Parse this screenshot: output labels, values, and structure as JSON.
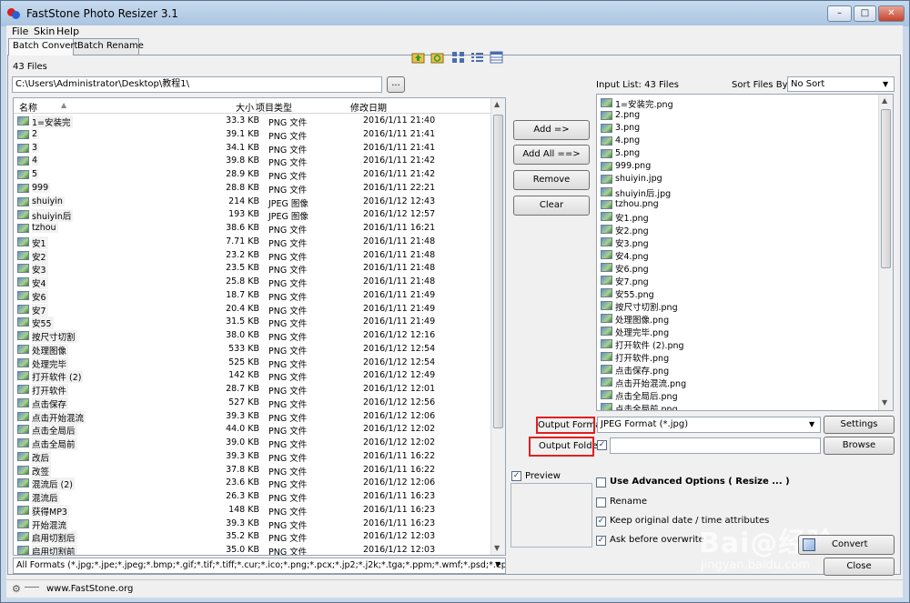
{
  "window": {
    "title": "FastStone Photo Resizer 3.1",
    "min_glyph": "–",
    "max_glyph": "□",
    "close_glyph": "✕"
  },
  "menu": [
    "File",
    "Skin",
    "Help"
  ],
  "tabs": [
    "Batch Convert",
    "Batch Rename"
  ],
  "file_count": "43 Files",
  "path": {
    "value": "C:\\Users\\Administrator\\Desktop\\教程1\\",
    "browse_label": "..."
  },
  "columns": {
    "name": "名称",
    "size": "大小",
    "type": "项目类型",
    "date": "修改日期"
  },
  "files": [
    {
      "name": "1=安装完",
      "size": "33.3 KB",
      "type": "PNG 文件",
      "date": "2016/1/11 21:40"
    },
    {
      "name": "2",
      "size": "39.1 KB",
      "type": "PNG 文件",
      "date": "2016/1/11 21:41"
    },
    {
      "name": "3",
      "size": "34.1 KB",
      "type": "PNG 文件",
      "date": "2016/1/11 21:41"
    },
    {
      "name": "4",
      "size": "39.8 KB",
      "type": "PNG 文件",
      "date": "2016/1/11 21:42"
    },
    {
      "name": "5",
      "size": "28.9 KB",
      "type": "PNG 文件",
      "date": "2016/1/11 21:42"
    },
    {
      "name": "999",
      "size": "28.8 KB",
      "type": "PNG 文件",
      "date": "2016/1/11 22:21"
    },
    {
      "name": "shuiyin",
      "size": "214 KB",
      "type": "JPEG 图像",
      "date": "2016/1/12 12:43"
    },
    {
      "name": "shuiyin后",
      "size": "193 KB",
      "type": "JPEG 图像",
      "date": "2016/1/12 12:57"
    },
    {
      "name": "tzhou",
      "size": "38.6 KB",
      "type": "PNG 文件",
      "date": "2016/1/11 16:21"
    },
    {
      "name": "安1",
      "size": "7.71 KB",
      "type": "PNG 文件",
      "date": "2016/1/11 21:48"
    },
    {
      "name": "安2",
      "size": "23.2 KB",
      "type": "PNG 文件",
      "date": "2016/1/11 21:48"
    },
    {
      "name": "安3",
      "size": "23.5 KB",
      "type": "PNG 文件",
      "date": "2016/1/11 21:48"
    },
    {
      "name": "安4",
      "size": "25.8 KB",
      "type": "PNG 文件",
      "date": "2016/1/11 21:48"
    },
    {
      "name": "安6",
      "size": "18.7 KB",
      "type": "PNG 文件",
      "date": "2016/1/11 21:49"
    },
    {
      "name": "安7",
      "size": "20.4 KB",
      "type": "PNG 文件",
      "date": "2016/1/11 21:49"
    },
    {
      "name": "安55",
      "size": "31.5 KB",
      "type": "PNG 文件",
      "date": "2016/1/11 21:49"
    },
    {
      "name": "按尺寸切割",
      "size": "38.0 KB",
      "type": "PNG 文件",
      "date": "2016/1/12 12:16"
    },
    {
      "name": "处理图像",
      "size": "533 KB",
      "type": "PNG 文件",
      "date": "2016/1/12 12:54"
    },
    {
      "name": "处理完毕",
      "size": "525 KB",
      "type": "PNG 文件",
      "date": "2016/1/12 12:54"
    },
    {
      "name": "打开软件 (2)",
      "size": "142 KB",
      "type": "PNG 文件",
      "date": "2016/1/12 12:49"
    },
    {
      "name": "打开软件",
      "size": "28.7 KB",
      "type": "PNG 文件",
      "date": "2016/1/12 12:01"
    },
    {
      "name": "点击保存",
      "size": "527 KB",
      "type": "PNG 文件",
      "date": "2016/1/12 12:56"
    },
    {
      "name": "点击开始混流",
      "size": "39.3 KB",
      "type": "PNG 文件",
      "date": "2016/1/12 12:06"
    },
    {
      "name": "点击全局后",
      "size": "44.0 KB",
      "type": "PNG 文件",
      "date": "2016/1/12 12:02"
    },
    {
      "name": "点击全局前",
      "size": "39.0 KB",
      "type": "PNG 文件",
      "date": "2016/1/12 12:02"
    },
    {
      "name": "改后",
      "size": "39.3 KB",
      "type": "PNG 文件",
      "date": "2016/1/11 16:22"
    },
    {
      "name": "改签",
      "size": "37.8 KB",
      "type": "PNG 文件",
      "date": "2016/1/11 16:22"
    },
    {
      "name": "混流后 (2)",
      "size": "23.6 KB",
      "type": "PNG 文件",
      "date": "2016/1/12 12:06"
    },
    {
      "name": "混流后",
      "size": "26.3 KB",
      "type": "PNG 文件",
      "date": "2016/1/11 16:23"
    },
    {
      "name": "获得MP3",
      "size": "148 KB",
      "type": "PNG 文件",
      "date": "2016/1/11 16:23"
    },
    {
      "name": "开始混流",
      "size": "39.3 KB",
      "type": "PNG 文件",
      "date": "2016/1/11 16:23"
    },
    {
      "name": "启用切割后",
      "size": "35.2 KB",
      "type": "PNG 文件",
      "date": "2016/1/12 12:03"
    },
    {
      "name": "启用切割前",
      "size": "35.0 KB",
      "type": "PNG 文件",
      "date": "2016/1/12 12:03"
    }
  ],
  "filter": "All Formats (*.jpg;*.jpe;*.jpeg;*.bmp;*.gif;*.tif;*.tiff;*.cur;*.ico;*.png;*.pcx;*.jp2;*.j2k;*.tga;*.ppm;*.wmf;*.psd;*.eps)",
  "actions": {
    "add": "Add =>",
    "add_all": "Add All ==>",
    "remove": "Remove",
    "clear": "Clear"
  },
  "input_list": {
    "label": "Input List:  43 Files",
    "sort_label": "Sort Files By:",
    "sort_value": "No Sort",
    "items": [
      "1=安装完.png",
      "2.png",
      "3.png",
      "4.png",
      "5.png",
      "999.png",
      "shuiyin.jpg",
      "shuiyin后.jpg",
      "tzhou.png",
      "安1.png",
      "安2.png",
      "安3.png",
      "安4.png",
      "安6.png",
      "安7.png",
      "安55.png",
      "按尺寸切割.png",
      "处理图像.png",
      "处理完毕.png",
      "打开软件 (2).png",
      "打开软件.png",
      "点击保存.png",
      "点击开始混流.png",
      "点击全局后.png",
      "点击全局前.png"
    ]
  },
  "output": {
    "format_label": "Output Format:",
    "format_value": "JPEG Format (*.jpg)",
    "settings": "Settings",
    "folder_label": "Output Folder:",
    "folder_value": "",
    "browse": "Browse"
  },
  "options": {
    "preview": "Preview",
    "advanced": "Use Advanced Options ( Resize ... )",
    "rename": "Rename",
    "keep_date": "Keep original date / time attributes",
    "ask_overwrite": "Ask before overwrite"
  },
  "buttons": {
    "convert": "Convert",
    "close": "Close"
  },
  "status": {
    "url": "www.FastStone.org"
  },
  "watermark": {
    "main": "Bai@经验",
    "sub": "jingyan.baidu.com"
  }
}
